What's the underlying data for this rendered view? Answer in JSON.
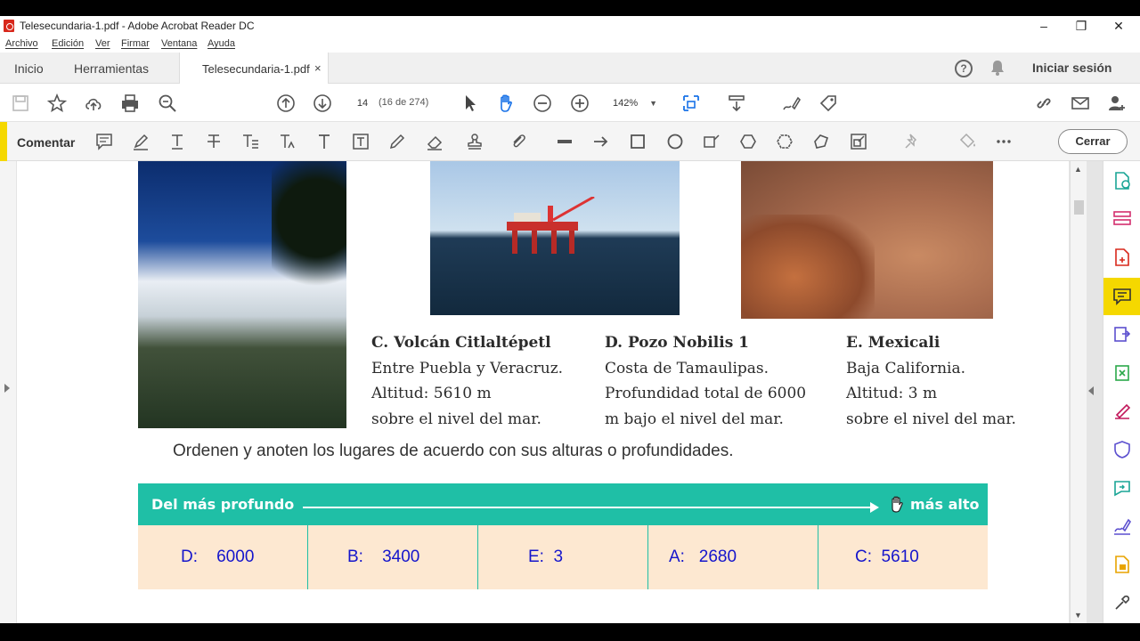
{
  "window": {
    "title": "Telesecundaria-1.pdf - Adobe Acrobat Reader DC",
    "minimize": "–",
    "restore": "❐",
    "close": "✕"
  },
  "menu": [
    "Archivo",
    "Edición",
    "Ver",
    "Firmar",
    "Ventana",
    "Ayuda"
  ],
  "tabs": {
    "home": "Inicio",
    "tools": "Herramientas",
    "document": "Telesecundaria-1.pdf",
    "close": "×",
    "help": "?",
    "signin": "Iniciar sesión"
  },
  "toolbar": {
    "page_number": "14",
    "page_count": "(16 de 274)",
    "zoom": "142%"
  },
  "comment_bar": {
    "label": "Comentar",
    "close_button": "Cerrar",
    "accent_color": "#f5d800"
  },
  "document": {
    "captions": [
      {
        "heading": "C. Volcán Citlaltépetl",
        "lines": [
          "Entre Puebla y Veracruz.",
          "Altitud: 5610 m",
          "sobre el nivel del mar."
        ]
      },
      {
        "heading": "D. Pozo Nobilis 1",
        "lines": [
          "Costa de Tamaulipas.",
          "Profundidad total de 6000",
          "m bajo el nivel del mar."
        ]
      },
      {
        "heading": "E. Mexicali",
        "lines": [
          "Baja California.",
          "Altitud: 3 m",
          "sobre el nivel del mar."
        ]
      }
    ],
    "instruction": "Ordenen y anoten los lugares de acuerdo con sus alturas o profundidades.",
    "banner": {
      "left": "Del más profundo",
      "right": "más alto",
      "color": "#1fbfa6"
    },
    "answers": [
      "D:    6000",
      "B:    3400",
      "E:  3",
      "A:   2680",
      "C:  5610"
    ],
    "answer_color": "#1515cc"
  }
}
